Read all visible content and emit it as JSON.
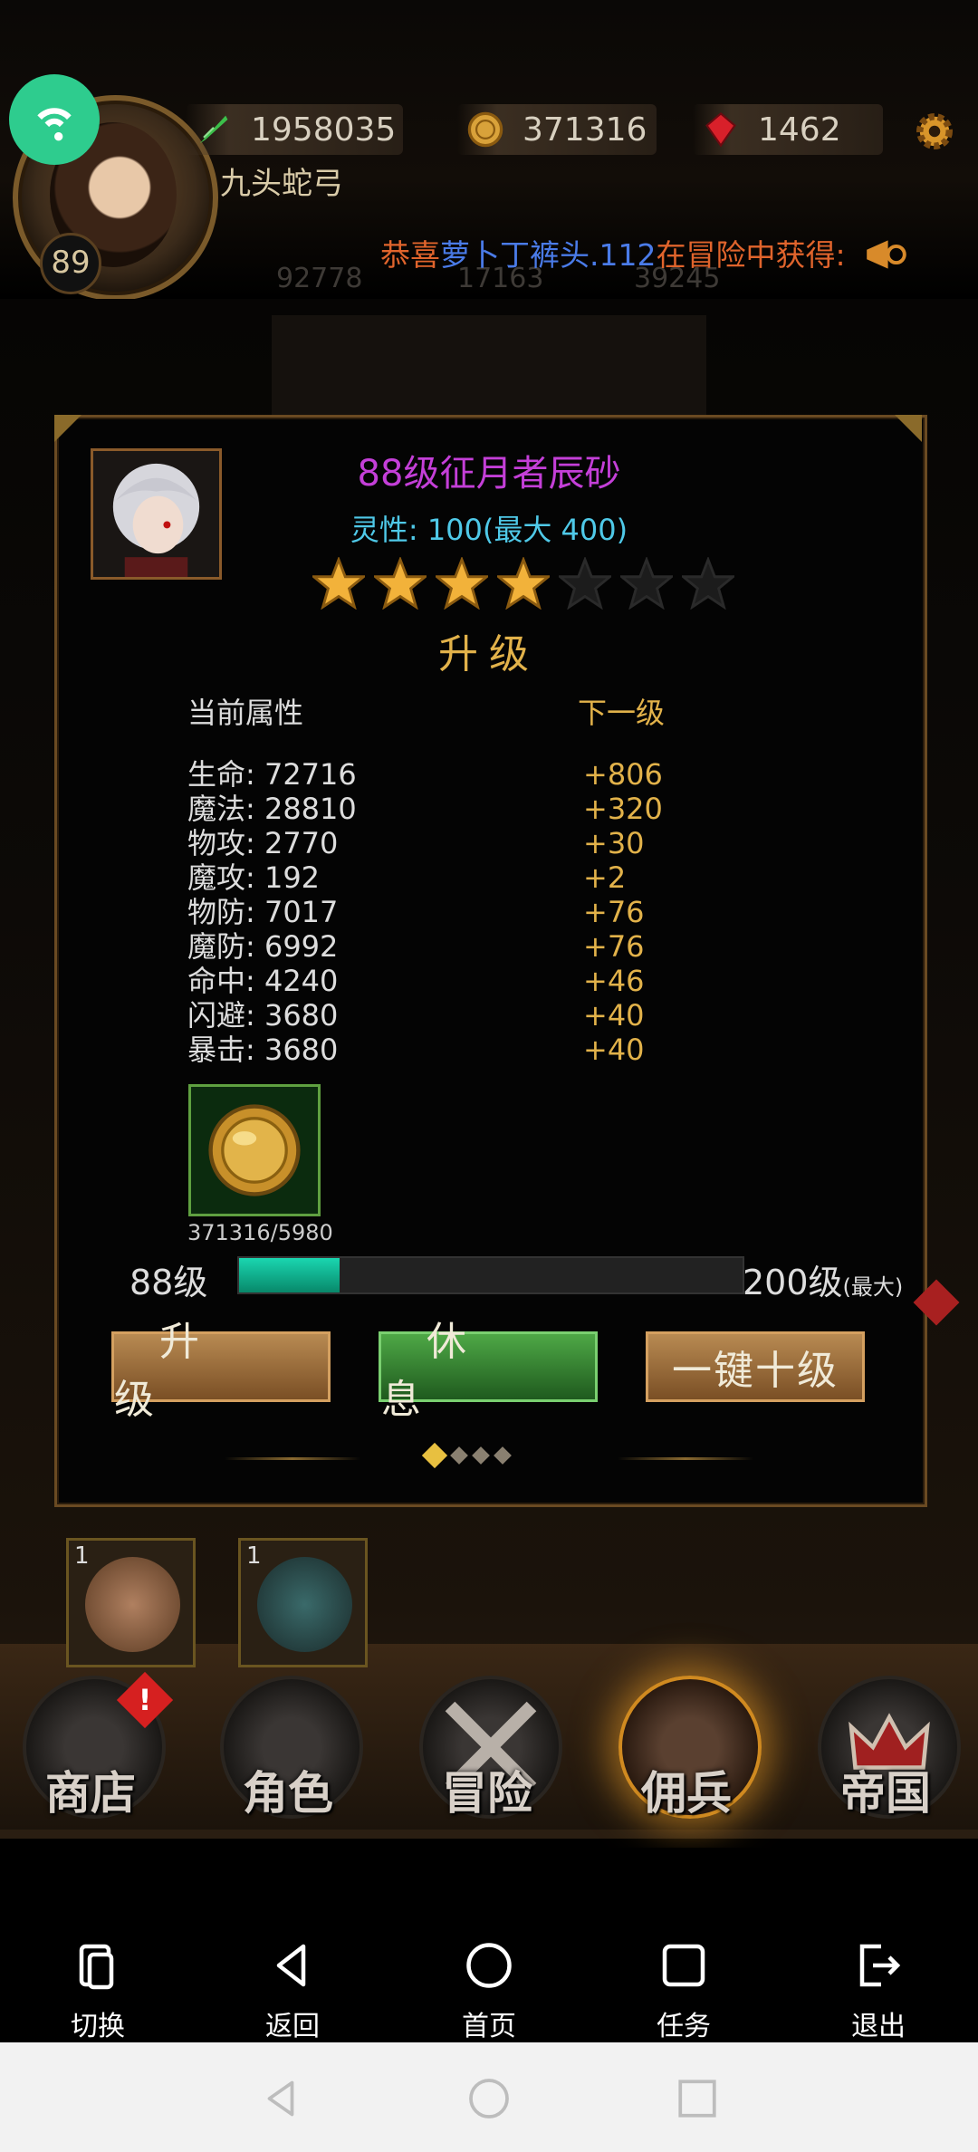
{
  "hud": {
    "player_name": "九头蛇弓",
    "level": "89",
    "resources": [
      {
        "icon": "feather-icon",
        "value": "1958035"
      },
      {
        "icon": "gold-coin-icon",
        "value": "371316"
      },
      {
        "icon": "red-gem-icon",
        "value": "1462"
      }
    ],
    "ticker": {
      "part1": "恭喜",
      "part2": "萝卜丁裤头.112",
      "part3": "在冒险中获得:"
    },
    "ghost_stats": [
      "92778",
      "17163",
      "39245"
    ]
  },
  "dialog": {
    "title": "88级征月者辰砂",
    "spirit": "灵性: 100(最大 400)",
    "stars_filled": 4,
    "stars_total": 7,
    "section_title": "升级",
    "header_current": "当前属性",
    "header_next": "下一级",
    "stats": [
      {
        "label": "生命: 72716",
        "next": "+806"
      },
      {
        "label": "魔法: 28810",
        "next": "+320"
      },
      {
        "label": "物攻: 2770",
        "next": "+30"
      },
      {
        "label": "魔攻: 192",
        "next": "+2"
      },
      {
        "label": "物防: 7017",
        "next": "+76"
      },
      {
        "label": "魔防: 6992",
        "next": "+76"
      },
      {
        "label": "命中: 4240",
        "next": "+46"
      },
      {
        "label": "闪避: 3680",
        "next": "+40"
      },
      {
        "label": "暴击: 3680",
        "next": "+40"
      }
    ],
    "cost_count": "371316/5980",
    "level_from": "88级",
    "level_to": "200级",
    "level_max_note": "(最大)",
    "progress": 0.2,
    "buttons": {
      "upgrade": "升级",
      "rest": "休息",
      "ten": "一键十级"
    },
    "pager_count": 4,
    "pager_active": 0
  },
  "slots": [
    {
      "count": "1"
    },
    {
      "count": "1"
    }
  ],
  "tabs": [
    {
      "label": "商店"
    },
    {
      "label": "角色"
    },
    {
      "label": "冒险"
    },
    {
      "label": "佣兵"
    },
    {
      "label": "帝国"
    }
  ],
  "alert_mark": "!",
  "emulator_nav": [
    {
      "label": "切换",
      "icon": "phone-switch-icon"
    },
    {
      "label": "返回",
      "icon": "back-triangle-icon"
    },
    {
      "label": "首页",
      "icon": "home-circle-icon"
    },
    {
      "label": "任务",
      "icon": "tasks-square-icon"
    },
    {
      "label": "退出",
      "icon": "exit-icon"
    }
  ],
  "colors": {
    "title": "#c43fd8",
    "spirit": "#4fc9e8",
    "gold_text": "#e2b24a",
    "bar_fill": "#1ad6b0"
  }
}
